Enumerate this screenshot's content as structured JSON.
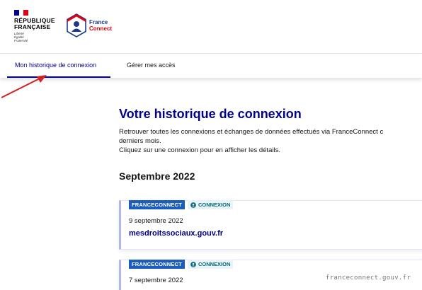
{
  "header": {
    "republic_line1": "RÉPUBLIQUE",
    "republic_line2": "FRANÇAISE",
    "motto_line1": "Liberté",
    "motto_line2": "Égalité",
    "motto_line3": "Fraternité",
    "fc_line1": "France",
    "fc_line2": "Connect",
    "colors": {
      "blue": "#000091",
      "red": "#e1000f"
    }
  },
  "tabs": [
    {
      "label": "Mon historique de connexion",
      "active": true
    },
    {
      "label": "Gérer mes accès",
      "active": false
    }
  ],
  "main": {
    "title": "Votre historique de connexion",
    "intro_line1": "Retrouver toutes les connexions et échanges de données effectués via FranceConnect c",
    "intro_line2": "derniers mois.",
    "intro_line3": "Cliquez sur une connexion pour en afficher les détails.",
    "month": "Septembre 2022"
  },
  "entries": [
    {
      "badge1": "FRANCECONNECT",
      "badge2": "CONNEXION",
      "badge2_icon": "user-circle-icon",
      "date": "9 septembre 2022",
      "site": "mesdroitssociaux.gouv.fr"
    },
    {
      "badge1": "FRANCECONNECT",
      "badge2": "CONNEXION",
      "badge2_icon": "user-circle-icon",
      "date": "7 septembre 2022",
      "site": ""
    }
  ],
  "watermark": "franceconnect.gouv.fr",
  "annotation": {
    "arrow_color": "#d42020"
  }
}
